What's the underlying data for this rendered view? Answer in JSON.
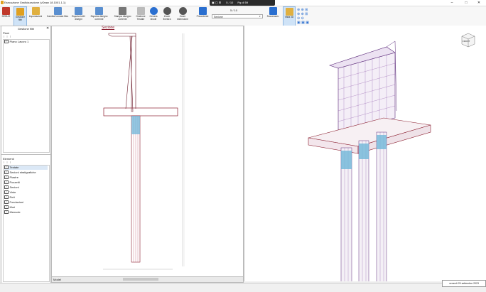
{
  "window": {
    "title": "Esecuzione Graficizzazione (vDraw 18.1001.1.1)",
    "min": "–",
    "max": "□",
    "close": "✕"
  },
  "overlay": {
    "page": "5 / 10",
    "zoom": "Pg di 59"
  },
  "ribbon": {
    "buttons": [
      {
        "label": "DEBUG",
        "icon": "debug-icon",
        "color": "#c0392b"
      },
      {
        "label": "Gestione filtri",
        "icon": "filter-icon",
        "color": "#e0a020",
        "active": true
      },
      {
        "label": "Impostazioni",
        "icon": "settings-icon",
        "color": "#e0b040"
      },
      {
        "label": "Cambia formato files",
        "icon": "file-format-icon",
        "color": "#5a8fd0"
      },
      {
        "label": "Esporta tutti i disegni",
        "icon": "export-all-icon",
        "color": "#5a8fd0"
      },
      {
        "label": "Esporta disegno corrente",
        "icon": "export-current-icon",
        "color": "#5a8fd0"
      },
      {
        "label": "Stampa disegno corrente",
        "icon": "print-icon",
        "color": "#777"
      },
      {
        "label": "Gestione Testate",
        "icon": "header-icon",
        "color": "#bbb"
      },
      {
        "label": "Genera tavole",
        "icon": "play-icon",
        "color": "#2a6fd0"
      },
      {
        "label": "Zoom finestra",
        "icon": "zoom-window-icon",
        "color": "#555"
      },
      {
        "label": "Zoom estensione",
        "icon": "zoom-extent-icon",
        "color": "#555"
      },
      {
        "label": "Precedente",
        "icon": "arrow-left-icon",
        "color": "#2a6fd0"
      },
      {
        "label": "Successivo",
        "icon": "arrow-right-icon",
        "color": "#2a6fd0"
      },
      {
        "label": "Vista 3D",
        "icon": "cube-3d-icon",
        "color": "#e0b040",
        "active": true
      }
    ],
    "page_counter": "5 / 10",
    "section_select": "Sezione"
  },
  "filters_panel": {
    "title": "Gestione filtri",
    "planes_label": "Piani",
    "planes": [
      {
        "label": "Piano Lavoro 1",
        "checked": true
      }
    ],
    "elements_label": "Elementi",
    "elements": [
      {
        "label": "Testate",
        "checked": true,
        "selected": true
      },
      {
        "label": "Sezioni stratigrafiche",
        "checked": true
      },
      {
        "label": "Piastre",
        "checked": true
      },
      {
        "label": "Pozzetti",
        "checked": true
      },
      {
        "label": "Sezioni",
        "checked": true
      },
      {
        "label": "Viste",
        "checked": true
      },
      {
        "label": "Reti",
        "checked": true
      },
      {
        "label": "Fondazioni",
        "checked": true
      },
      {
        "label": "Muri",
        "checked": true
      },
      {
        "label": "Mensole",
        "checked": true
      }
    ]
  },
  "drawing": {
    "section_title": "Sezione",
    "tab": "Model"
  },
  "view3d": {
    "cube_label": "FRONT"
  },
  "status": {
    "date": "venerdì 29 settembre 2023"
  }
}
